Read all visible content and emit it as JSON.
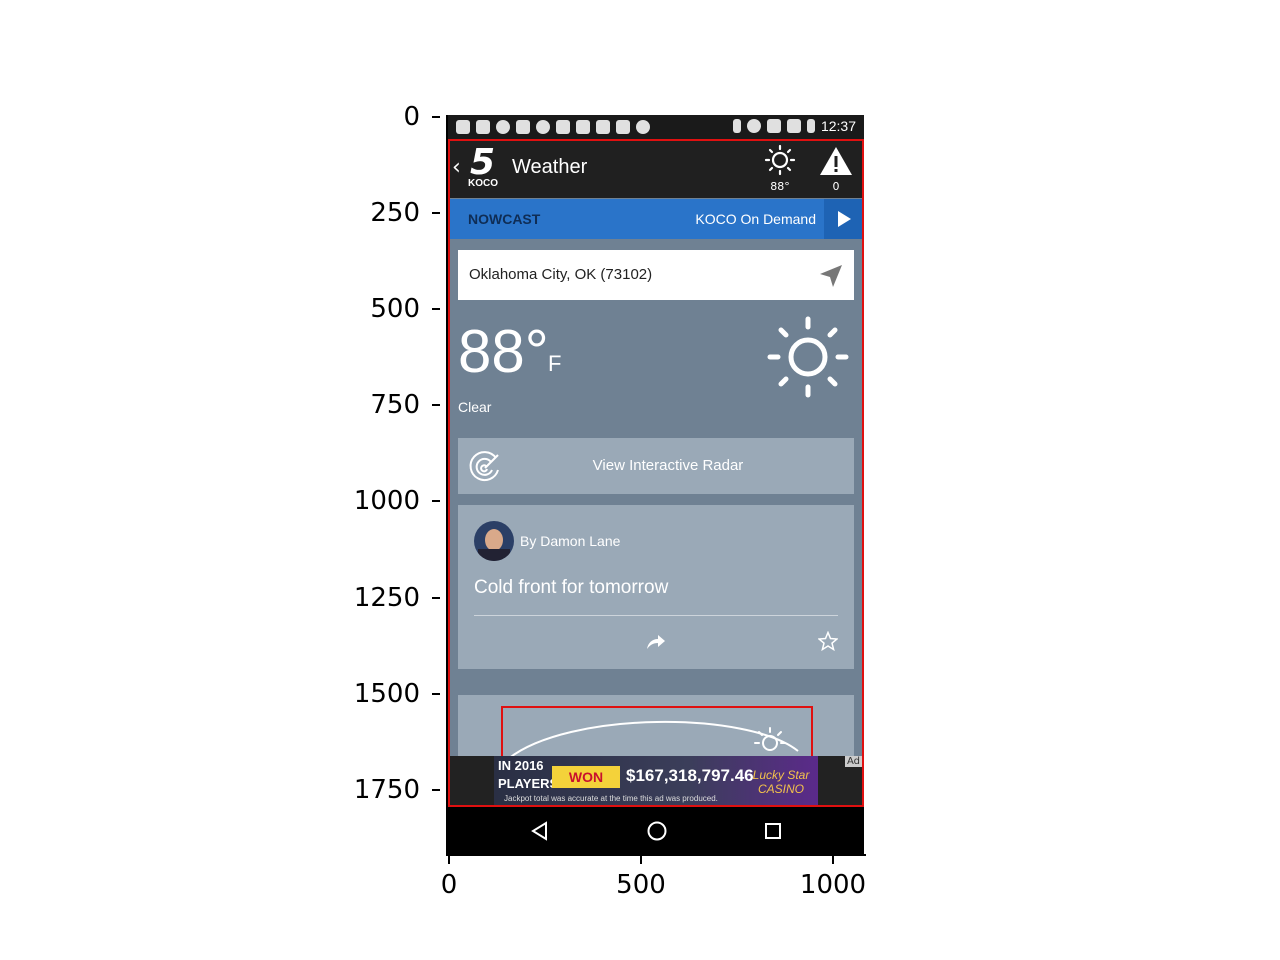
{
  "axes": {
    "yticks": [
      "0",
      "250",
      "500",
      "750",
      "1000",
      "1250",
      "1500",
      "1750"
    ],
    "xticks": [
      "0",
      "500",
      "1000"
    ]
  },
  "statusbar": {
    "time": "12:37"
  },
  "appbar": {
    "title": "Weather",
    "logo_number": "5",
    "logo_text": "KOCO",
    "current_temp": "88°",
    "alert_count": "0"
  },
  "nowcast_bar": {
    "left_label": "NOWCAST",
    "right_label": "KOCO On Demand"
  },
  "location": {
    "text": "Oklahoma City, OK (73102)"
  },
  "current": {
    "temperature": "88°",
    "unit": "F",
    "condition": "Clear"
  },
  "radar": {
    "label": "View Interactive Radar"
  },
  "story": {
    "byline": "By Damon Lane",
    "headline": "Cold front for tomorrow"
  },
  "ad": {
    "year_line": "IN 2016",
    "players_line": "PLAYERS",
    "won_text": "WON",
    "amount": "$167,318,797.46",
    "fine_print": "Jackpot total was accurate at the time this ad was produced.",
    "brand": "Lucky Star CASINO",
    "tag": "Ad"
  },
  "colors": {
    "nowcast_blue": "#2a74c9",
    "appbar": "#202020",
    "highlight_red": "#e01010"
  },
  "icons": {
    "header_weather": "sun-icon",
    "header_alert": "warning-icon",
    "location": "location-arrow-icon",
    "radar": "radar-icon",
    "share": "share-icon",
    "favorite": "star-icon"
  }
}
